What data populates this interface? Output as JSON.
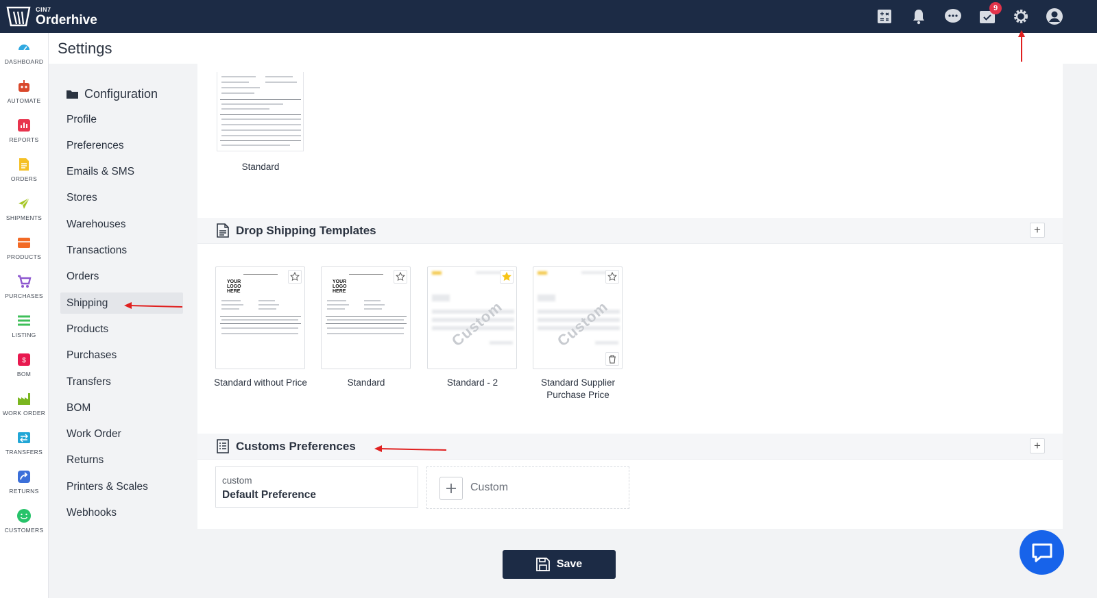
{
  "app": {
    "brand_sub": "CIN7",
    "brand_name": "Orderhive",
    "notification_badge": "9"
  },
  "top_icons": [
    "calculator-icon",
    "bell-icon",
    "chat-icon",
    "tasks-icon",
    "gear-icon",
    "user-icon"
  ],
  "rail": [
    {
      "label": "DASHBOARD",
      "icon": "dashboard-icon",
      "color": "#2fa8e0"
    },
    {
      "label": "AUTOMATE",
      "icon": "robot-icon",
      "color": "#d9482b"
    },
    {
      "label": "REPORTS",
      "icon": "reports-icon",
      "color": "#e8344e"
    },
    {
      "label": "ORDERS",
      "icon": "orders-icon",
      "color": "#f5c024"
    },
    {
      "label": "SHIPMENTS",
      "icon": "plane-icon",
      "color": "#a6c626"
    },
    {
      "label": "PRODUCTS",
      "icon": "box-icon",
      "color": "#f26a25"
    },
    {
      "label": "PURCHASES",
      "icon": "cart-icon",
      "color": "#8e58cf"
    },
    {
      "label": "LISTING",
      "icon": "listing-icon",
      "color": "#3fbf5a"
    },
    {
      "label": "BOM",
      "icon": "bom-icon",
      "color": "#e8194f"
    },
    {
      "label": "WORK ORDER",
      "icon": "factory-icon",
      "color": "#7ab61f"
    },
    {
      "label": "TRANSFERS",
      "icon": "transfer-icon",
      "color": "#21a6d6"
    },
    {
      "label": "RETURNS",
      "icon": "return-icon",
      "color": "#3b6fd9"
    },
    {
      "label": "CUSTOMERS",
      "icon": "smile-icon",
      "color": "#27c36a"
    }
  ],
  "header": {
    "title": "Settings"
  },
  "settings_nav": {
    "heading": "Configuration",
    "items": [
      "Profile",
      "Preferences",
      "Emails & SMS",
      "Stores",
      "Warehouses",
      "Transactions",
      "Orders",
      "Shipping",
      "Products",
      "Purchases",
      "Transfers",
      "BOM",
      "Work Order",
      "Returns",
      "Printers & Scales",
      "Webhooks"
    ],
    "active": "Shipping"
  },
  "top_template": {
    "label": "Standard"
  },
  "drop_shipping": {
    "title": "Drop Shipping Templates",
    "add_label": "+",
    "templates": [
      {
        "label": "Standard without Price",
        "starred": false
      },
      {
        "label": "Standard",
        "starred": false
      },
      {
        "label": "Standard - 2",
        "starred": true
      },
      {
        "label": "Standard Supplier Purchase Price",
        "starred": false
      }
    ],
    "logo_text": "YOUR LOGO HERE",
    "watermark": "Custom"
  },
  "customs": {
    "title": "Customs Preferences",
    "add_label": "+",
    "card_sub": "custom",
    "card_name": "Default Preference",
    "new_label": "Custom"
  },
  "footer": {
    "save_label": "Save"
  },
  "colors": {
    "navy": "#1c2b45",
    "accent_arrow": "#e0201f",
    "star_gold": "#f7c415",
    "chat_blue": "#1763ea"
  }
}
